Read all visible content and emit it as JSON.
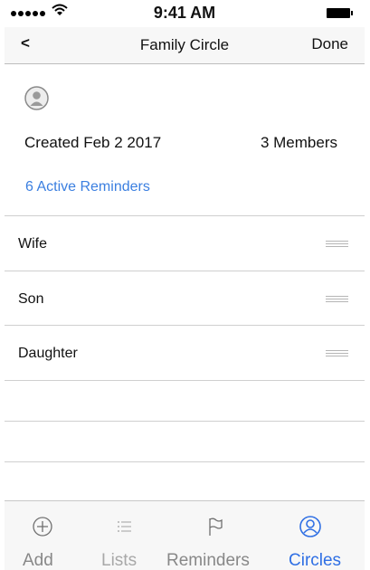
{
  "status_bar": {
    "time": "9:41 AM"
  },
  "nav": {
    "back_label": "<",
    "title": "Family Circle",
    "done_label": "Done"
  },
  "circle": {
    "created": "Created Feb 2 2017",
    "members_count": "3 Members",
    "active_reminders": "6 Active Reminders"
  },
  "members": [
    {
      "name": "Wife"
    },
    {
      "name": "Son"
    },
    {
      "name": "Daughter"
    }
  ],
  "tabs": [
    {
      "label": "Add",
      "icon": "plus-circle-icon",
      "active": false,
      "disabled": false
    },
    {
      "label": "Lists",
      "icon": "list-icon",
      "active": false,
      "disabled": true
    },
    {
      "label": "Reminders",
      "icon": "flag-icon",
      "active": false,
      "disabled": false
    },
    {
      "label": "Circles",
      "icon": "person-circle-icon",
      "active": true,
      "disabled": false
    }
  ],
  "colors": {
    "accent": "#2f6fe4",
    "link": "#3b7fe0",
    "tab_inactive": "#888888",
    "tab_disabled": "#a8a8a8"
  }
}
